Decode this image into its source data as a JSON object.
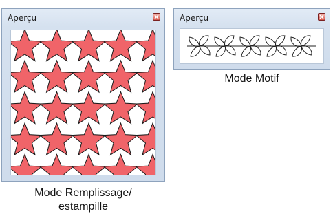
{
  "fill_panel": {
    "title": "Aperçu",
    "close_label": "Fermer",
    "star_fill": "#f06469",
    "star_stroke": "#1a1a1a",
    "rows": 5,
    "cols": 5
  },
  "motif_panel": {
    "title": "Aperçu",
    "close_label": "Fermer",
    "motif_count": 5
  },
  "captions": {
    "fill_line1": "Mode Remplissage/",
    "fill_line2": "estampille",
    "motif": "Mode Motif"
  },
  "colors": {
    "panel_border": "#8ea3bd",
    "panel_bg": "#d5e1ef",
    "close_red": "#d7574b"
  }
}
